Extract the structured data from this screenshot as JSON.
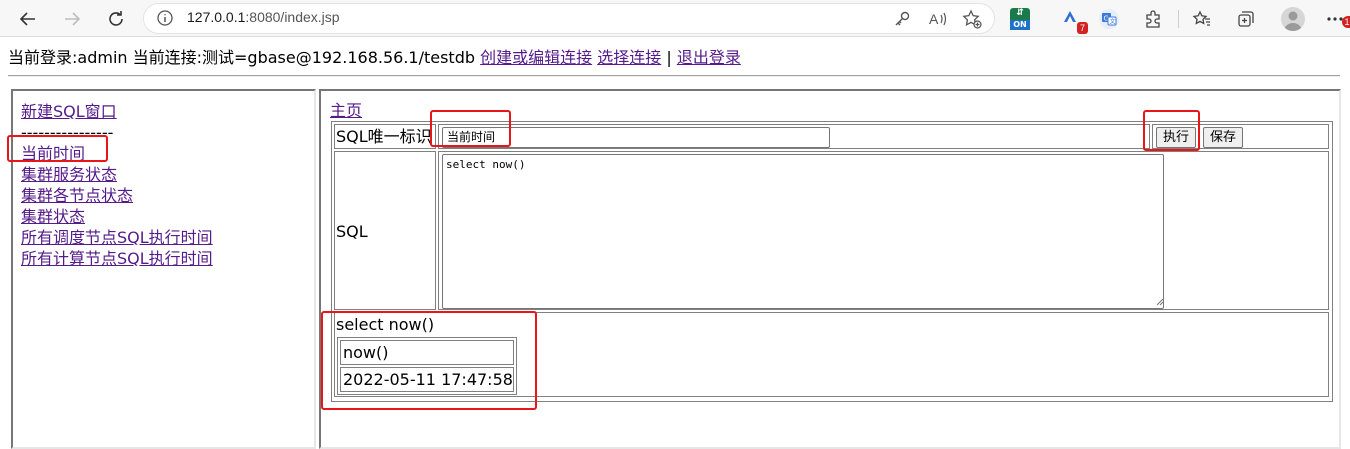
{
  "browser": {
    "url_host": "127.0.0.1",
    "url_rest": ":8080/index.jsp",
    "extension_on_label": "ON",
    "extension_badge_count": "7",
    "notification_badge": "1",
    "accent_red": "#e8151b"
  },
  "header": {
    "login_label": "当前登录:admin 当前连接:测试=gbase@192.168.56.1/testdb",
    "create_edit_link": "创建或编辑连接",
    "select_link": "选择连接",
    "separator": "|",
    "logout_link": "退出登录"
  },
  "sidebar": {
    "new_window_link": "新建SQL窗口",
    "divider": "----------------",
    "items": [
      "当前时间",
      "集群服务状态",
      "集群各节点状态",
      "集群状态",
      "所有调度节点SQL执行时间",
      "所有计算节点SQL执行时间"
    ]
  },
  "main": {
    "home_link": "主页",
    "id_label": "SQL唯一标识",
    "id_value": "当前时间",
    "execute_button": "执行",
    "save_button": "保存",
    "sql_label": "SQL",
    "sql_text": "select now()",
    "result_title": "select now()",
    "result_header": "now()",
    "result_value": "2022-05-11 17:47:58.0"
  }
}
